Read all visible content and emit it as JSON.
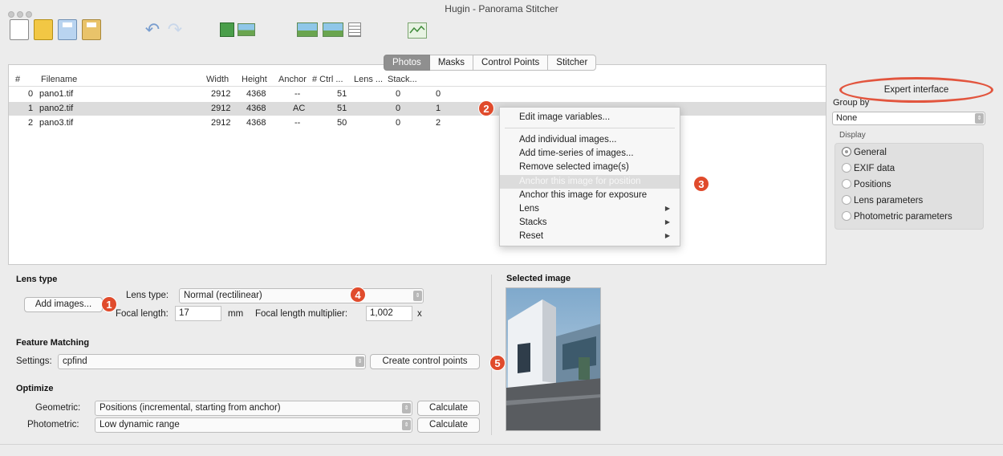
{
  "window": {
    "title": "Hugin - Panorama Stitcher"
  },
  "toolbar": {
    "icons": [
      "new-project-icon",
      "open-project-icon",
      "save-icon",
      "save-as-icon",
      "undo-icon",
      "redo-icon",
      "add-images-icon",
      "add-series-icon",
      "fast-preview-icon",
      "preview-icon",
      "list-icon",
      "optimizer-icon"
    ]
  },
  "tabs": [
    "Photos",
    "Masks",
    "Control Points",
    "Stitcher"
  ],
  "active_tab": "Photos",
  "table": {
    "columns": [
      "#",
      "Filename",
      "Width",
      "Height",
      "Anchor",
      "# Ctrl ...",
      "Lens ...",
      "Stack..."
    ],
    "rows": [
      {
        "num": "0",
        "filename": "pano1.tif",
        "width": "2912",
        "height": "4368",
        "anchor": "--",
        "ctrl": "51",
        "lens": "0",
        "stack": "0"
      },
      {
        "num": "1",
        "filename": "pano2.tif",
        "width": "2912",
        "height": "4368",
        "anchor": "AC",
        "ctrl": "51",
        "lens": "0",
        "stack": "1"
      },
      {
        "num": "2",
        "filename": "pano3.tif",
        "width": "2912",
        "height": "4368",
        "anchor": "--",
        "ctrl": "50",
        "lens": "0",
        "stack": "2"
      }
    ]
  },
  "context_menu": {
    "items": [
      {
        "label": "Edit image variables..."
      },
      {
        "label": "Add individual images..."
      },
      {
        "label": "Add time-series of images..."
      },
      {
        "label": "Remove selected image(s)"
      },
      {
        "label": "Anchor this image for position"
      },
      {
        "label": "Anchor this image for exposure"
      },
      {
        "label": "Lens"
      },
      {
        "label": "Stacks"
      },
      {
        "label": "Reset"
      }
    ]
  },
  "right_panel": {
    "expert_label": "Expert interface",
    "group_by_label": "Group by",
    "group_by_value": "None",
    "display_label": "Display",
    "display_options": [
      "General",
      "EXIF data",
      "Positions",
      "Lens parameters",
      "Photometric parameters"
    ],
    "display_selected": "General"
  },
  "lens": {
    "section_title": "Lens type",
    "add_images_label": "Add images...",
    "lens_type_label": "Lens type:",
    "lens_type_value": "Normal (rectilinear)",
    "focal_length_label": "Focal length:",
    "focal_length_value": "17",
    "focal_unit": "mm",
    "multiplier_label": "Focal length multiplier:",
    "multiplier_value": "1,002",
    "multiplier_unit": "x"
  },
  "feature": {
    "section_title": "Feature Matching",
    "settings_label": "Settings:",
    "settings_value": "cpfind",
    "create_label": "Create control points"
  },
  "optimize": {
    "section_title": "Optimize",
    "geometric_label": "Geometric:",
    "geometric_value": "Positions (incremental, starting from anchor)",
    "photometric_label": "Photometric:",
    "photometric_value": "Low dynamic range",
    "calculate_label": "Calculate"
  },
  "selected_image": {
    "title": "Selected image"
  },
  "badges": [
    "1",
    "2",
    "3",
    "4",
    "5"
  ],
  "colors": {
    "badge": "#e04b2c",
    "highlight_ring": "#e2553e",
    "active_tab": "#8f8f8f"
  }
}
